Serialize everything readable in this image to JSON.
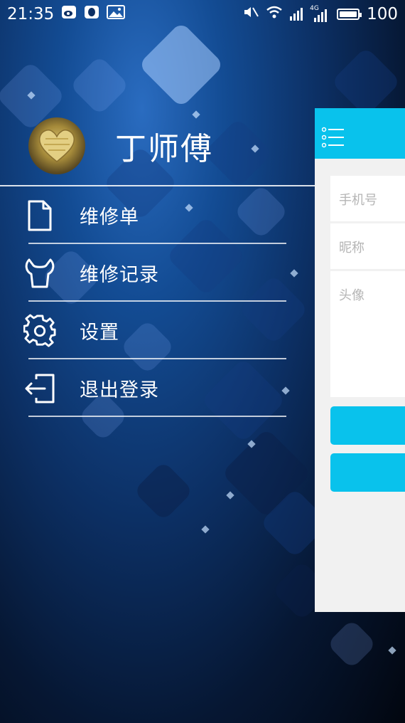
{
  "status_bar": {
    "time": "21:35",
    "battery_level": "100",
    "network_type": "4G",
    "left_icons": [
      "weibo-icon",
      "qq-icon",
      "image-icon"
    ],
    "right_icons": [
      "mute-icon",
      "wifi-icon",
      "signal-icon",
      "4g-signal-icon",
      "battery-icon"
    ]
  },
  "drawer": {
    "user_name": "丁师傅",
    "menu": [
      {
        "label": "维修单",
        "icon": "document-icon"
      },
      {
        "label": "维修记录",
        "icon": "wrench-icon"
      },
      {
        "label": "设置",
        "icon": "gear-icon"
      },
      {
        "label": "退出登录",
        "icon": "logout-icon"
      }
    ]
  },
  "main": {
    "header_icon": "list-menu-icon",
    "fields": {
      "phone_placeholder": "手机号",
      "nickname_placeholder": "昵称",
      "avatar_placeholder": "头像"
    }
  },
  "colors": {
    "accent": "#09c2ec",
    "panel_background": "#f1f1f1",
    "drawer_background": "#0c2f63"
  }
}
